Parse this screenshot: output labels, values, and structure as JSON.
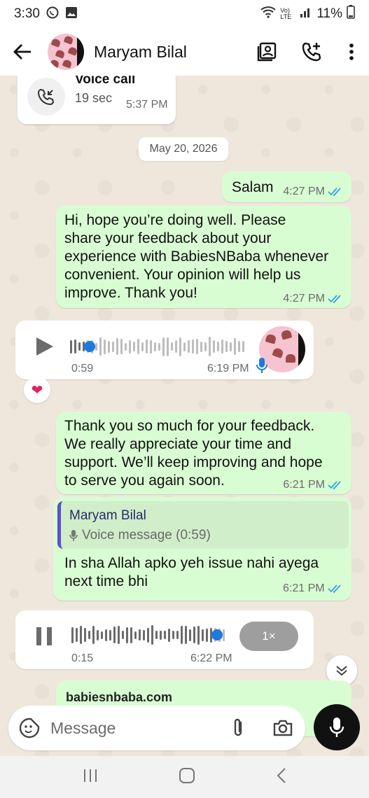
{
  "status": {
    "time": "3:30",
    "battery": "11%",
    "net": "Vo) LTE"
  },
  "header": {
    "contact_name": "Maryam Bilal"
  },
  "call": {
    "title": "Voice call",
    "duration": "19 sec",
    "time": "5:37 PM"
  },
  "date_chip": "May 20, 2026",
  "messages": {
    "m1": {
      "text": "Salam",
      "time": "4:27 PM"
    },
    "m2": {
      "lines": [
        "Hi, hope you’re doing well. Please",
        "share your feedback about your",
        "experience with BabiesNBaba whenever",
        "convenient. Your opinion will help us",
        "improve. Thank you!"
      ],
      "time": "4:27 PM"
    },
    "voice1": {
      "duration": "0:59",
      "time": "6:19 PM",
      "progress": 0.1
    },
    "reaction": "❤",
    "m3": {
      "lines": [
        "Thank you so much for your feedback.",
        "We really appreciate your time and",
        "support. We’ll keep improving and hope",
        "to serve you again soon."
      ],
      "time": "6:21 PM"
    },
    "m4": {
      "quote_name": "Maryam Bilal",
      "quote_text": "Voice message (0:59)",
      "lines": [
        "In sha Allah apko yeh issue nahi ayega",
        "next time bhi"
      ],
      "time": "6:21 PM"
    },
    "voice2": {
      "duration": "0:15",
      "time": "6:22 PM",
      "speed": "1×",
      "progress": 0.92
    },
    "m5": {
      "text": "babiesnbaba.com"
    }
  },
  "input": {
    "placeholder": "Message"
  },
  "colors": {
    "outgoing": "#d9fdd3",
    "incoming": "#ffffff",
    "tick": "#34a3e8",
    "accent": "#1f7ae0"
  }
}
